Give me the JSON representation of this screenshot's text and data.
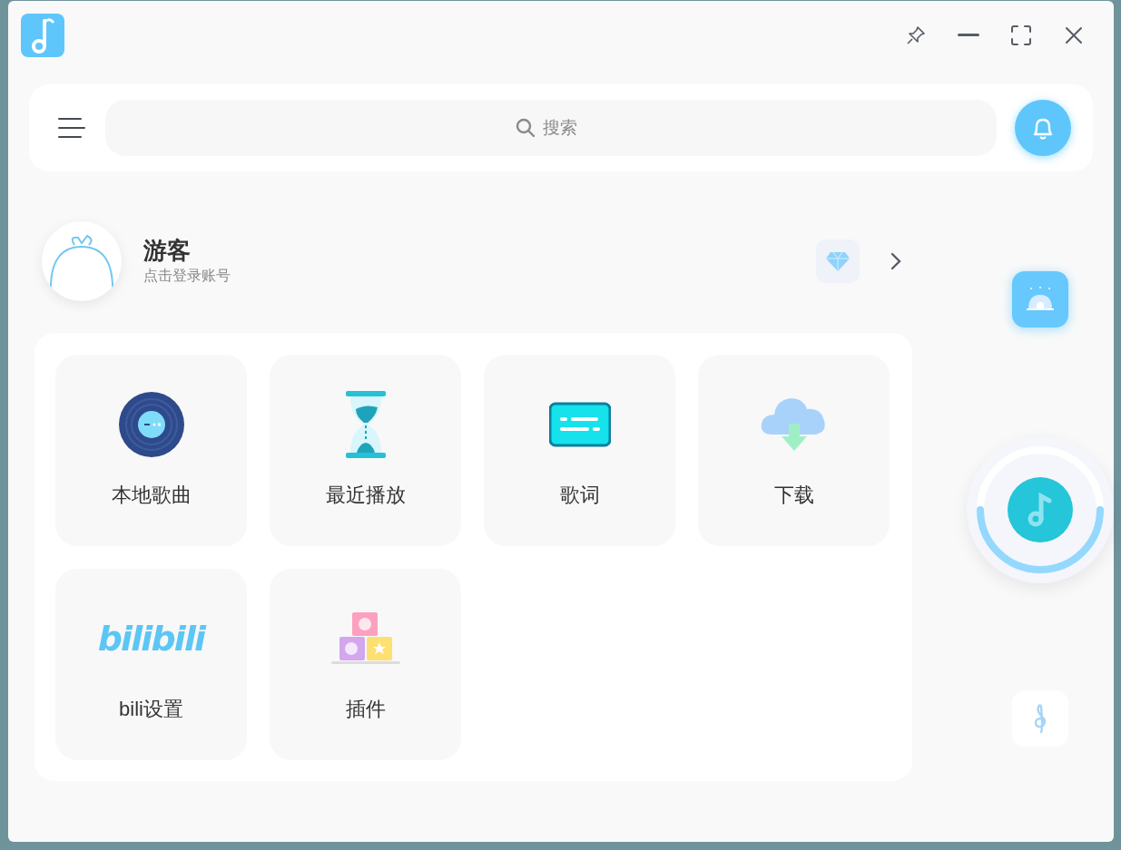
{
  "search": {
    "placeholder": "搜索"
  },
  "profile": {
    "name": "游客",
    "subtitle": "点击登录账号"
  },
  "tiles": [
    {
      "kind": "vinyl",
      "label": "本地歌曲"
    },
    {
      "kind": "hourglass",
      "label": "最近播放"
    },
    {
      "kind": "lyrics",
      "label": "歌词"
    },
    {
      "kind": "download",
      "label": "下载"
    },
    {
      "kind": "bili",
      "logo_text": "bilibili",
      "label": "bili设置"
    },
    {
      "kind": "blocks",
      "label": "插件"
    }
  ]
}
